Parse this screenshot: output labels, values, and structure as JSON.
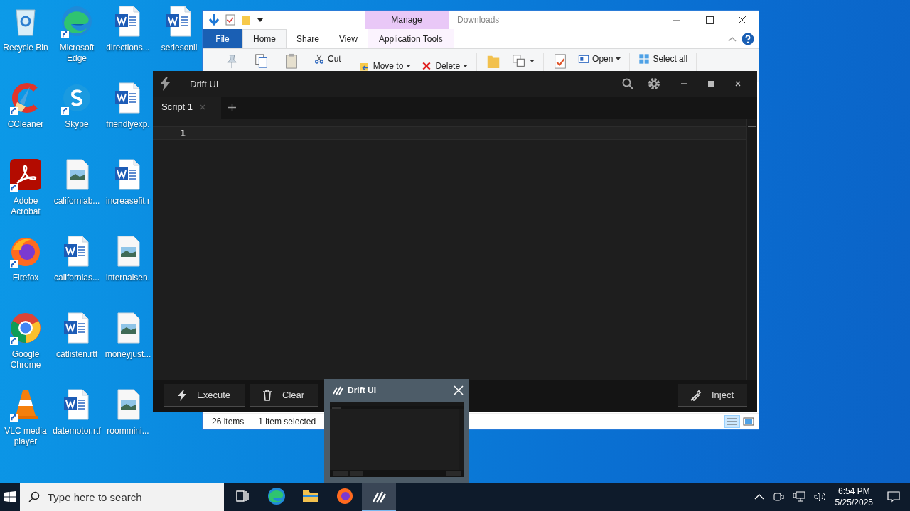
{
  "desktop": {
    "icons": [
      {
        "label": "Recycle Bin",
        "kind": "recycle",
        "shortcut": false
      },
      {
        "label": "CCleaner",
        "kind": "ccleaner",
        "shortcut": true
      },
      {
        "label": "Adobe Acrobat",
        "kind": "acrobat",
        "shortcut": true
      },
      {
        "label": "Firefox",
        "kind": "firefox",
        "shortcut": true
      },
      {
        "label": "Google Chrome",
        "kind": "chrome",
        "shortcut": true
      },
      {
        "label": "VLC media player",
        "kind": "vlc",
        "shortcut": true
      },
      {
        "label": "Microsoft Edge",
        "kind": "edge",
        "shortcut": true
      },
      {
        "label": "Skype",
        "kind": "skype",
        "shortcut": true
      },
      {
        "label": "californiab...",
        "kind": "image",
        "shortcut": false
      },
      {
        "label": "californias...",
        "kind": "word",
        "shortcut": false
      },
      {
        "label": "catlisten.rtf",
        "kind": "word",
        "shortcut": false
      },
      {
        "label": "datemotor.rtf",
        "kind": "word",
        "shortcut": false
      },
      {
        "label": "directions...",
        "kind": "word",
        "shortcut": false
      },
      {
        "label": "friendlyexp.",
        "kind": "word",
        "shortcut": false
      },
      {
        "label": "increasefit.r",
        "kind": "word",
        "shortcut": false
      },
      {
        "label": "internalsen.",
        "kind": "image",
        "shortcut": false
      },
      {
        "label": "moneyjust...",
        "kind": "image",
        "shortcut": false
      },
      {
        "label": "roommini...",
        "kind": "image",
        "shortcut": false
      },
      {
        "label": "seriesonli",
        "kind": "word",
        "shortcut": false
      }
    ]
  },
  "explorer": {
    "context_tab": "Manage",
    "title": "Downloads",
    "tabs": [
      {
        "label": "File",
        "kind": "file",
        "selected": false
      },
      {
        "label": "Home",
        "kind": "normal",
        "selected": true
      },
      {
        "label": "Share",
        "kind": "normal",
        "selected": false
      },
      {
        "label": "View",
        "kind": "normal",
        "selected": false
      },
      {
        "label": "Application Tools",
        "kind": "context",
        "selected": false
      }
    ],
    "ribbon_groups": [
      [
        {
          "kind": "pin"
        },
        {
          "kind": "copy"
        },
        {
          "kind": "paste"
        },
        {
          "kind": "cut",
          "label": "Cut"
        }
      ],
      [
        {
          "kind": "move",
          "label": "Move to",
          "dropdown": true
        },
        {
          "kind": "delete",
          "label": "Delete",
          "dropdown": true
        }
      ],
      [
        {
          "kind": "folder"
        },
        {
          "kind": "copyto",
          "dropdown": true
        }
      ],
      [
        {
          "kind": "properties"
        },
        {
          "kind": "open",
          "label": "Open",
          "dropdown": true
        }
      ],
      [
        {
          "kind": "selectall",
          "label": "Select all"
        }
      ]
    ],
    "status": {
      "count": "26 items",
      "selection": "1 item selected"
    }
  },
  "drift": {
    "title": "Drift UI",
    "tabs": [
      {
        "label": "Script 1",
        "selected": true
      }
    ],
    "line_numbers": [
      "1"
    ],
    "buttons": [
      {
        "label": "Execute",
        "kind": "execute"
      },
      {
        "label": "Clear",
        "kind": "clear"
      },
      {
        "label": "Inject",
        "kind": "inject"
      }
    ]
  },
  "preview": {
    "title": "Drift UI"
  },
  "taskbar": {
    "search": {
      "placeholder": "Type here to search"
    },
    "apps": [
      {
        "kind": "taskview",
        "selected": false
      },
      {
        "kind": "edge",
        "selected": false
      },
      {
        "kind": "explorer",
        "selected": false
      },
      {
        "kind": "firefox",
        "selected": false
      },
      {
        "kind": "drift",
        "selected": true
      }
    ],
    "time": "6:54 PM",
    "date": "5/25/2025"
  }
}
